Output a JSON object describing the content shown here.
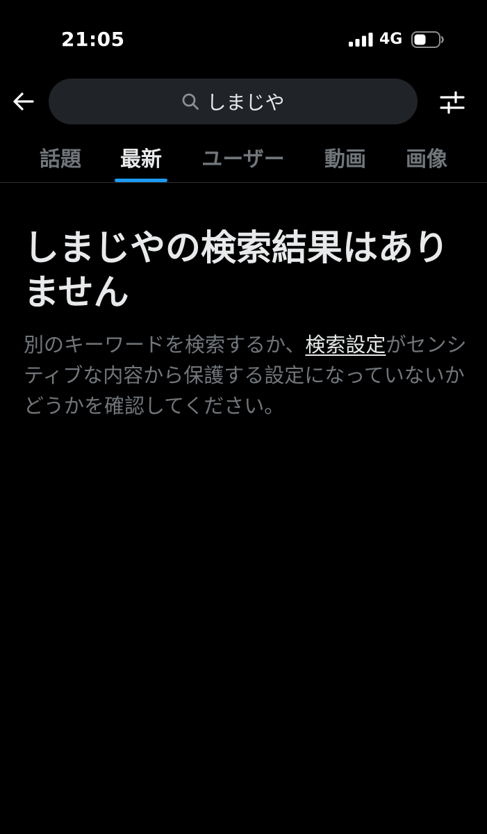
{
  "status_bar": {
    "time": "21:05",
    "network": "4G",
    "icons": [
      "signal-icon",
      "battery-icon"
    ]
  },
  "header": {
    "back_icon": "arrow-left-icon",
    "search_query": "しまじや",
    "search_icon": "search-icon",
    "filter_icon": "sliders-icon"
  },
  "tabs": [
    {
      "label": "話題",
      "active": false
    },
    {
      "label": "最新",
      "active": true
    },
    {
      "label": "ユーザー",
      "active": false
    },
    {
      "label": "動画",
      "active": false
    },
    {
      "label": "画像",
      "active": false
    }
  ],
  "empty_state": {
    "title": "しまじやの検索結果はありません",
    "body_before": "別のキーワードを検索するか、",
    "link_text": "検索設定",
    "body_after": "がセンシティブな内容から保護する設定になっていないかどうかを確認してください。"
  },
  "colors": {
    "background": "#000000",
    "text_primary": "#e7e9ea",
    "text_secondary": "#71767b",
    "accent": "#1d9bf0",
    "search_bg": "#202327",
    "divider": "#2f3336"
  }
}
